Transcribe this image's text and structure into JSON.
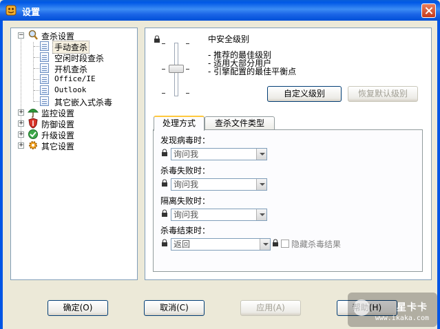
{
  "window": {
    "title": "设置"
  },
  "tree": {
    "items": [
      {
        "label": "查杀设置",
        "expanded": true
      },
      {
        "label": "手动查杀",
        "selected": true
      },
      {
        "label": "空闲时段查杀"
      },
      {
        "label": "开机查杀"
      },
      {
        "label": "Office/IE"
      },
      {
        "label": "Outlook"
      },
      {
        "label": "其它嵌入式杀毒"
      },
      {
        "label": "监控设置",
        "expanded": false
      },
      {
        "label": "防御设置",
        "expanded": false
      },
      {
        "label": "升级设置",
        "expanded": false
      },
      {
        "label": "其它设置",
        "expanded": false
      }
    ]
  },
  "level": {
    "title": "中安全级别",
    "desc": [
      "- 推荐的最佳级别",
      "- 适用大部分用户",
      "- 引擎配置的最佳平衡点"
    ],
    "custom_button": "自定义级别",
    "restore_button": "恢复默认级别",
    "slider_step": 2,
    "slider_steps": 4
  },
  "tabs": [
    {
      "label": "处理方式",
      "active": true
    },
    {
      "label": "查杀文件类型"
    }
  ],
  "handling": {
    "found_label": "发现病毒时：",
    "found_value": "询问我",
    "kill_fail_label": "杀毒失败时：",
    "kill_fail_value": "询问我",
    "quarantine_fail_label": "隔离失败时：",
    "quarantine_fail_value": "询问我",
    "kill_end_label": "杀毒结束时：",
    "kill_end_value": "返回",
    "hide_results_label": "隐藏杀毒结果"
  },
  "buttons": {
    "ok": "确定(O)",
    "cancel": "取消(C)",
    "apply": "应用(A)",
    "help": "帮助(H)"
  },
  "watermark": {
    "logo": "星卡卡",
    "url": "www.ikaka.com"
  },
  "colors": {
    "titlebar": "#0058E6",
    "accent": "#FFC83C",
    "border": "#7F9DB9"
  }
}
